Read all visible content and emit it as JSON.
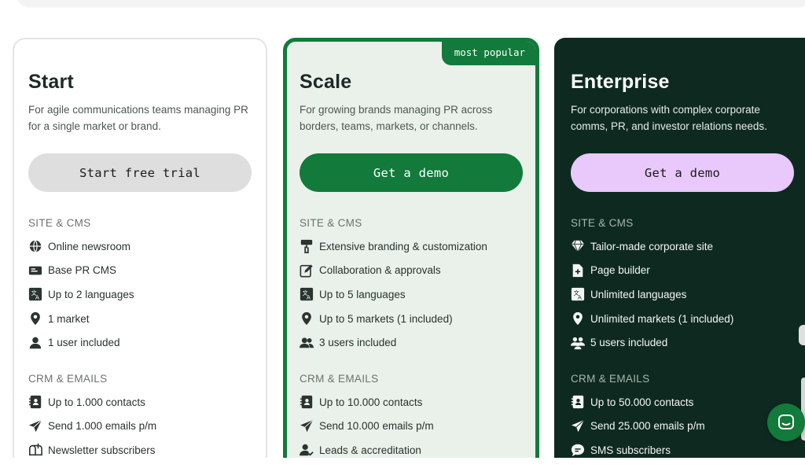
{
  "colors": {
    "brand_green": "#127a3a",
    "enterprise_bg": "#0e2a20",
    "lilac": "#e9c9fb"
  },
  "plans": [
    {
      "title": "Start",
      "description": "For agile communications teams managing PR for a single market or brand.",
      "cta": "Start free trial",
      "section1_title": "SITE & CMS",
      "section1_items": [
        {
          "icon": "globe-icon",
          "label": "Online newsroom"
        },
        {
          "icon": "cms-card-icon",
          "label": "Base PR CMS"
        },
        {
          "icon": "translate-icon",
          "label": "Up to 2 languages"
        },
        {
          "icon": "map-pin-icon",
          "label": "1 market"
        },
        {
          "icon": "user-icon",
          "label": "1 user included"
        }
      ],
      "section2_title": "CRM & EMAILS",
      "section2_items": [
        {
          "icon": "contacts-book-icon",
          "label": "Up to 1.000 contacts"
        },
        {
          "icon": "send-icon",
          "label": "Send 1.000 emails p/m"
        },
        {
          "icon": "mailbox-icon",
          "label": "Newsletter subscribers"
        }
      ]
    },
    {
      "title": "Scale",
      "badge": "most popular",
      "description": "For growing brands managing PR across borders, teams, markets, or channels.",
      "cta": "Get a demo",
      "section1_title": "SITE & CMS",
      "section1_items": [
        {
          "icon": "paint-roller-icon",
          "label": "Extensive branding & customization"
        },
        {
          "icon": "edit-icon",
          "label": "Collaboration & approvals"
        },
        {
          "icon": "translate-icon",
          "label": "Up to 5 languages"
        },
        {
          "icon": "map-pin-icon",
          "label": "Up to 5 markets (1 included)"
        },
        {
          "icon": "users-icon",
          "label": "3 users included"
        }
      ],
      "section2_title": "CRM & EMAILS",
      "section2_items": [
        {
          "icon": "contacts-book-icon",
          "label": "Up to 10.000 contacts"
        },
        {
          "icon": "send-icon",
          "label": "Send 10.000 emails p/m"
        },
        {
          "icon": "user-check-icon",
          "label": "Leads & accreditation"
        }
      ]
    },
    {
      "title": "Enterprise",
      "description": "For corporations with complex corporate comms, PR, and investor relations needs.",
      "cta": "Get a demo",
      "section1_title": "SITE & CMS",
      "section1_items": [
        {
          "icon": "diamond-icon",
          "label": "Tailor-made corporate site"
        },
        {
          "icon": "page-add-icon",
          "label": "Page builder"
        },
        {
          "icon": "translate-icon",
          "label": "Unlimited languages"
        },
        {
          "icon": "map-pin-icon",
          "label": "Unlimited markets (1 included)"
        },
        {
          "icon": "users-group-icon",
          "label": "5 users included"
        }
      ],
      "section2_title": "CRM & EMAILS",
      "section2_items": [
        {
          "icon": "contacts-book-icon",
          "label": "Up to 50.000 contacts"
        },
        {
          "icon": "send-icon",
          "label": "Send 25.000 emails p/m"
        },
        {
          "icon": "chat-bubble-icon",
          "label": "SMS subscribers"
        }
      ]
    }
  ]
}
